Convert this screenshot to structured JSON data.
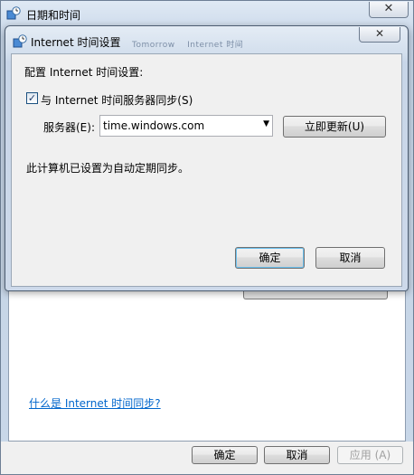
{
  "outer_window": {
    "title": "日期和时间",
    "close_label": "✕",
    "link_text": "什么是 Internet 时间同步?",
    "buttons": {
      "ok": "确定",
      "cancel": "取消",
      "apply": "应用 (A)"
    }
  },
  "inner_dialog": {
    "title": "Internet 时间设置",
    "ghost_text_1": "Tomorrow",
    "ghost_text_2": "Internet 时间",
    "close_label": "✕",
    "section_label": "配置 Internet 时间设置:",
    "sync_checkbox": {
      "label": "与 Internet 时间服务器同步(S)",
      "checked": true,
      "mark": "✓"
    },
    "server": {
      "label": "服务器(E):",
      "value": "time.windows.com",
      "arrow": "▼"
    },
    "update_button": "立即更新(U)",
    "status": "此计算机已设置为自动定期同步。",
    "buttons": {
      "ok": "确定",
      "cancel": "取消"
    }
  },
  "icons": {
    "title_icon": "clock-globe-icon"
  },
  "colors": {
    "link": "#0066cc",
    "window_frame": "#c8d6e8",
    "dialog_body": "#f0f0f0"
  }
}
